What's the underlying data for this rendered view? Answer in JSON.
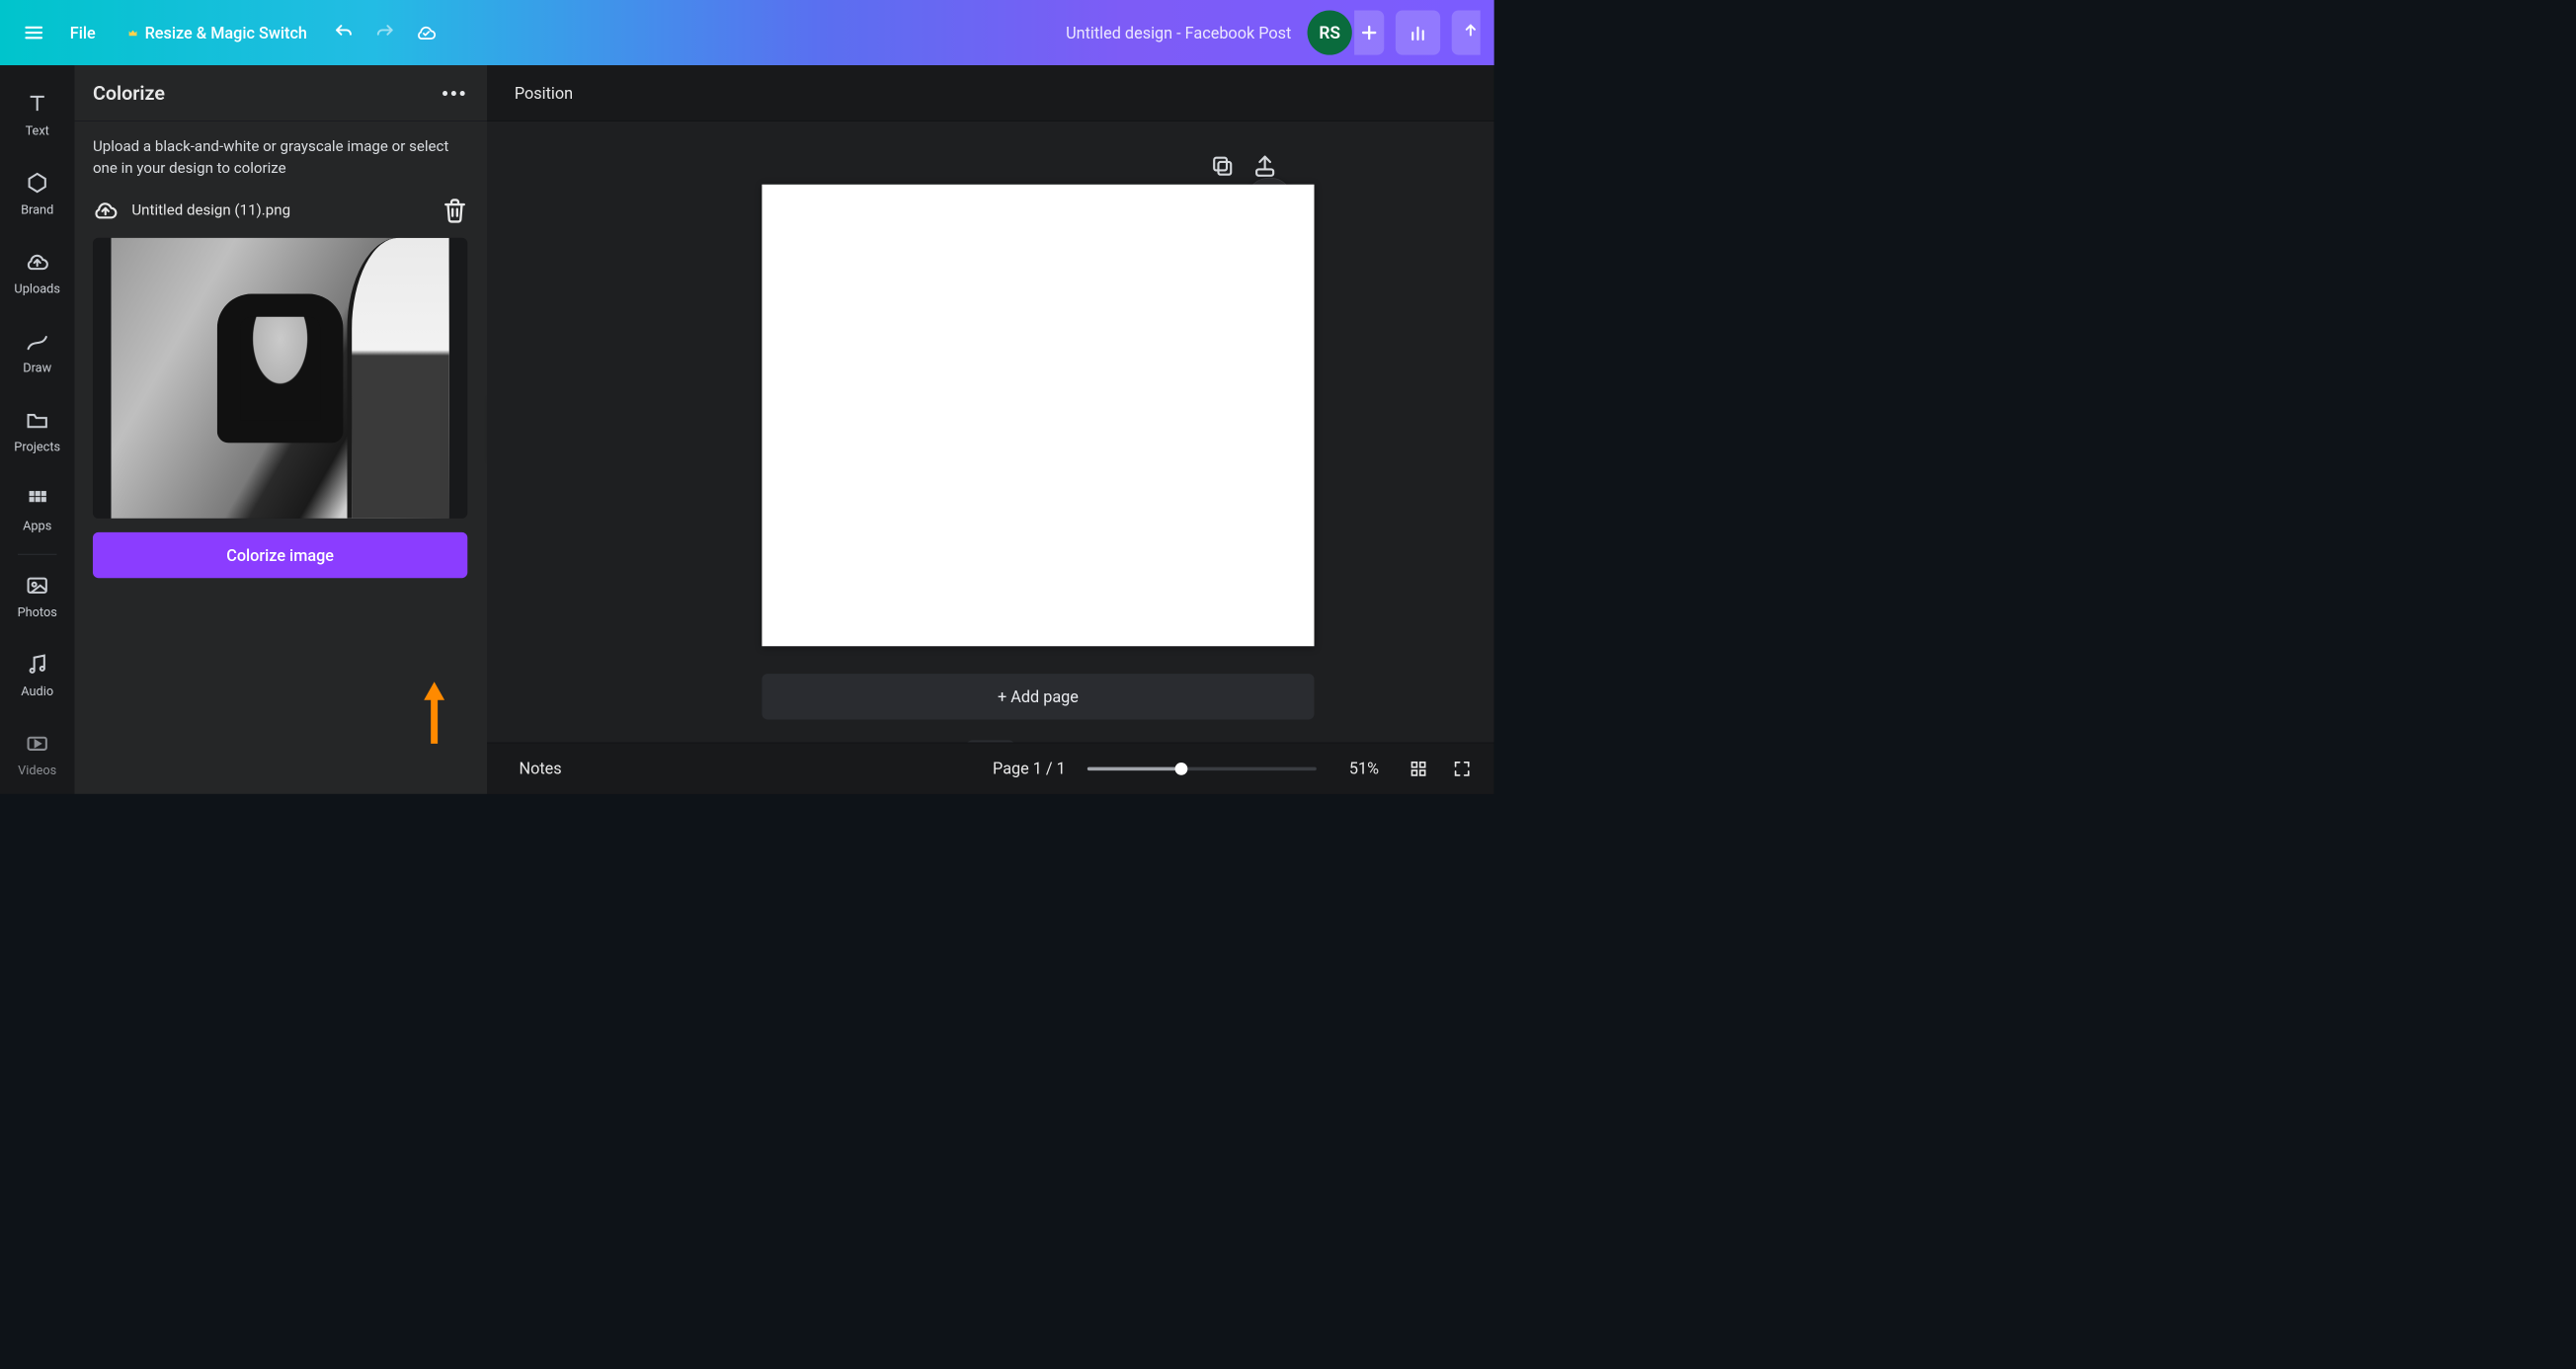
{
  "topbar": {
    "file_label": "File",
    "resize_label": "Resize & Magic Switch",
    "design_title": "Untitled design - Facebook Post",
    "avatar_initials": "RS"
  },
  "rail": {
    "items": [
      {
        "id": "text",
        "label": "Text"
      },
      {
        "id": "brand",
        "label": "Brand"
      },
      {
        "id": "uploads",
        "label": "Uploads"
      },
      {
        "id": "draw",
        "label": "Draw"
      },
      {
        "id": "projects",
        "label": "Projects"
      },
      {
        "id": "apps",
        "label": "Apps"
      },
      {
        "id": "photos",
        "label": "Photos"
      },
      {
        "id": "audio",
        "label": "Audio"
      },
      {
        "id": "videos",
        "label": "Videos"
      }
    ]
  },
  "panel": {
    "title": "Colorize",
    "description": "Upload a black-and-white or grayscale image or select one in your design to colorize",
    "file_name": "Untitled design (11).png",
    "primary_button": "Colorize image"
  },
  "toolbar": {
    "position_label": "Position"
  },
  "canvas_area": {
    "add_page_label": "+ Add page"
  },
  "bottombar": {
    "notes_label": "Notes",
    "page_label": "Page 1 / 1",
    "zoom_label": "51%",
    "zoom_value": 51
  },
  "colors": {
    "accent": "#8b3dff",
    "avatar_bg": "#0a6b3d",
    "annotation_arrow": "#ff8a00"
  }
}
